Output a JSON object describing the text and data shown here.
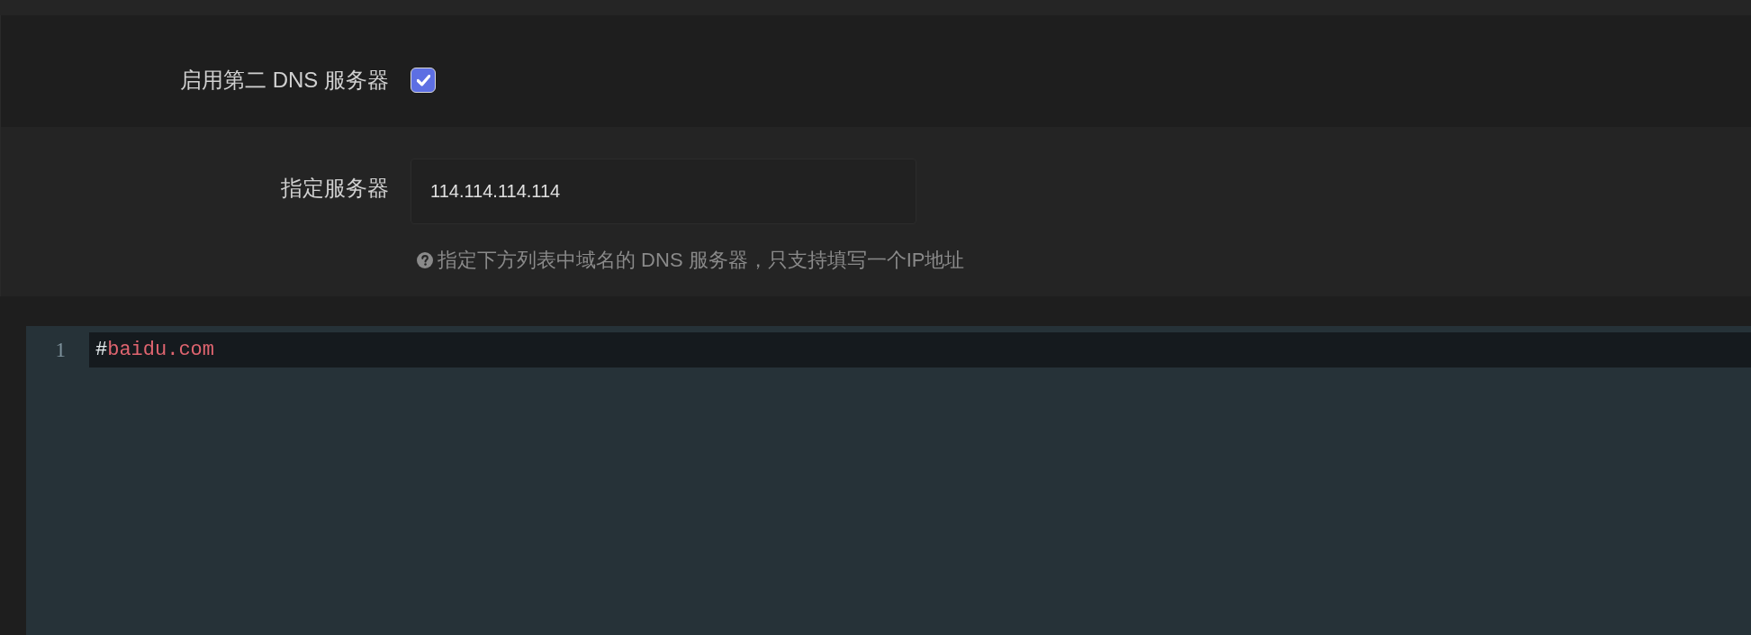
{
  "settings": [
    {
      "kind": "checkbox",
      "label": "启用第二 DNS 服务器",
      "checked": true
    },
    {
      "kind": "text",
      "label": "指定服务器",
      "value": "114.114.114.114",
      "help": "指定下方列表中域名的 DNS 服务器，只支持填写一个IP地址"
    }
  ],
  "editor": {
    "lines": [
      {
        "number": "1",
        "active": true,
        "tokens": [
          {
            "kind": "marker",
            "text": "#"
          },
          {
            "kind": "domain",
            "text": "baidu.com"
          }
        ]
      }
    ]
  }
}
